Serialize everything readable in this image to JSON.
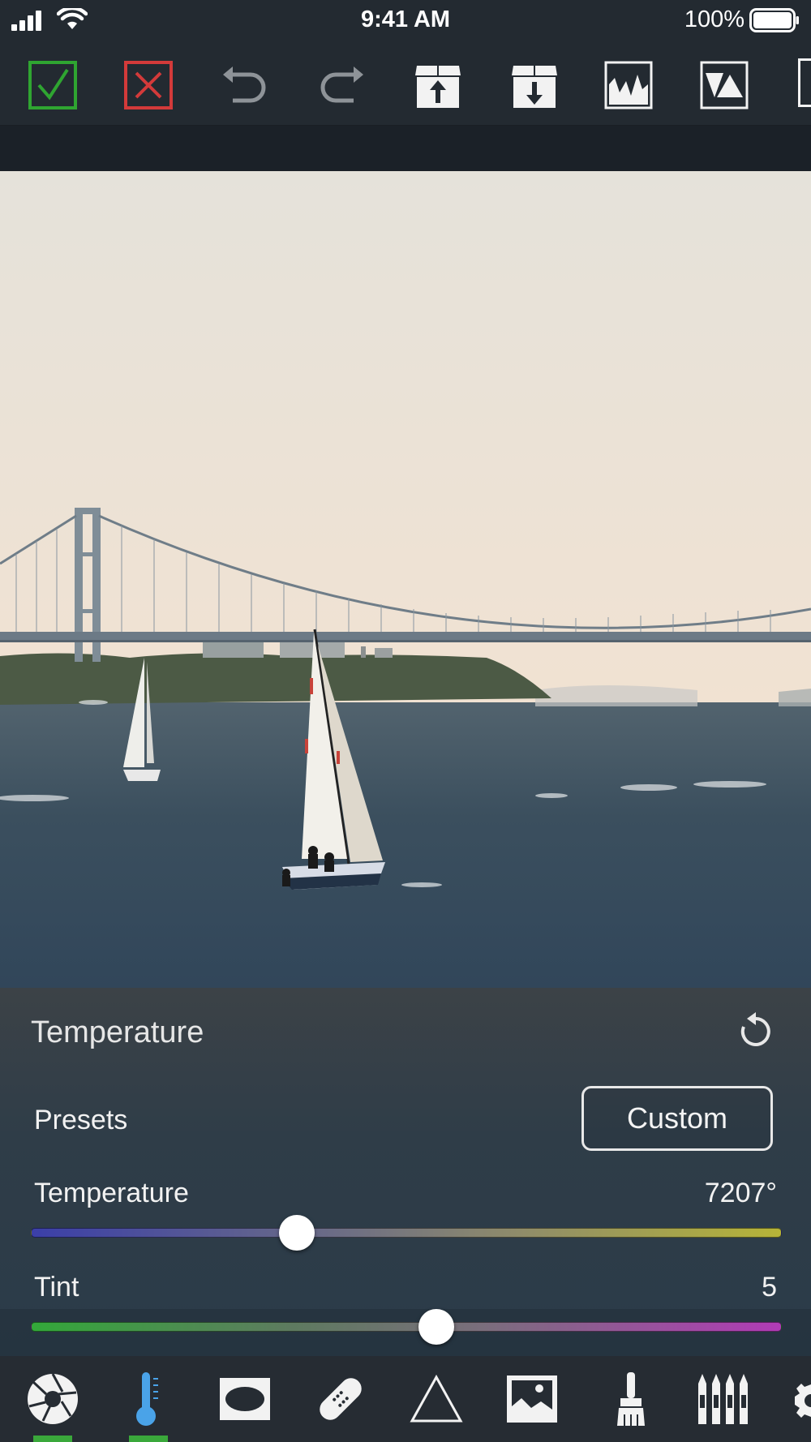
{
  "status_bar": {
    "time": "9:41 AM",
    "battery_percent": "100%"
  },
  "toolbar": {
    "items": [
      {
        "name": "apply",
        "icon": "check-icon",
        "color": "#2fa531"
      },
      {
        "name": "cancel",
        "icon": "close-icon",
        "color": "#d33a3a"
      },
      {
        "name": "undo",
        "icon": "undo-icon"
      },
      {
        "name": "redo",
        "icon": "redo-icon"
      },
      {
        "name": "export",
        "icon": "box-upload-icon"
      },
      {
        "name": "import",
        "icon": "box-download-icon"
      },
      {
        "name": "histogram",
        "icon": "histogram-icon"
      },
      {
        "name": "compare",
        "icon": "triangles-icon"
      }
    ]
  },
  "panel": {
    "title": "Temperature",
    "presets_label": "Presets",
    "presets_value": "Custom",
    "temperature": {
      "label": "Temperature",
      "value": "7207°",
      "position": 0.355
    },
    "tint": {
      "label": "Tint",
      "value": "5",
      "position": 0.541
    }
  },
  "bottom_tools": [
    {
      "name": "aperture",
      "icon": "aperture-icon",
      "active": true
    },
    {
      "name": "temperature",
      "icon": "thermometer-icon",
      "active": true,
      "color": "#4aa3e8"
    },
    {
      "name": "vignette",
      "icon": "ellipse-icon"
    },
    {
      "name": "heal",
      "icon": "bandage-icon"
    },
    {
      "name": "shape",
      "icon": "triangle-icon"
    },
    {
      "name": "image",
      "icon": "landscape-image-icon"
    },
    {
      "name": "brush",
      "icon": "brush-icon"
    },
    {
      "name": "crayons",
      "icon": "crayons-icon"
    }
  ]
}
